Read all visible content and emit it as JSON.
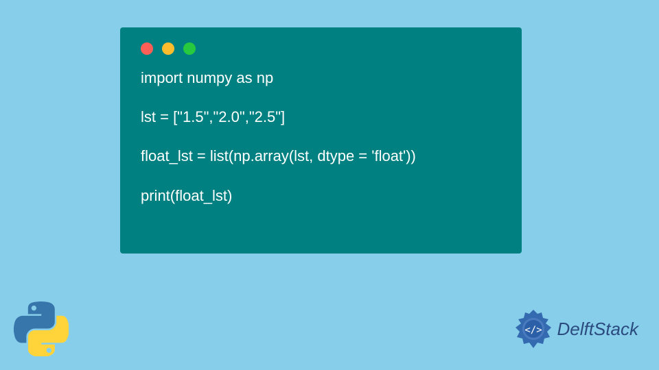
{
  "code": {
    "line1": "import numpy as np",
    "line2": "",
    "line3": "lst = [\"1.5\",\"2.0\",\"2.5\"]",
    "line4": "",
    "line5": "float_lst = list(np.array(lst, dtype = 'float'))",
    "line6": "",
    "line7": "print(float_lst)"
  },
  "branding": {
    "name": "DelftStack"
  }
}
